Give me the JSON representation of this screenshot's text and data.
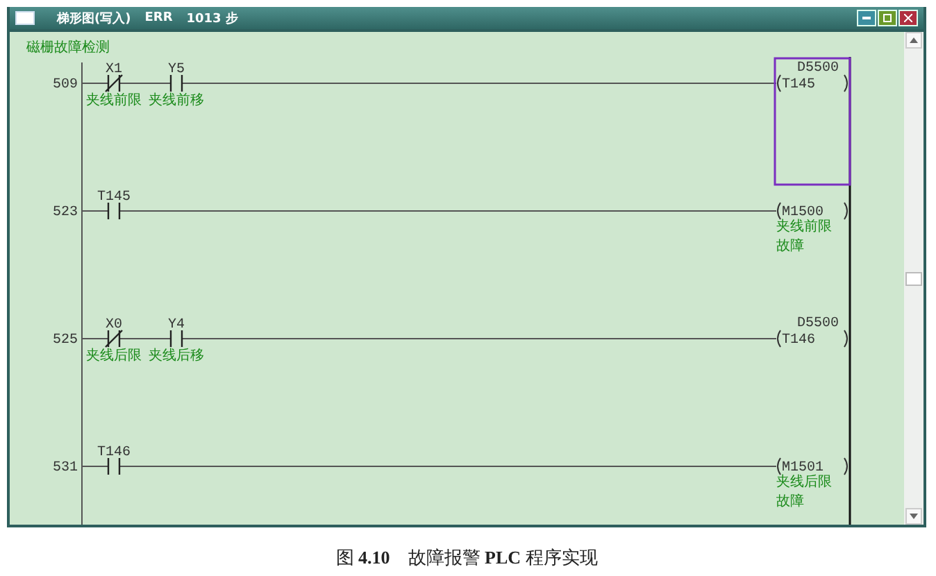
{
  "window": {
    "title": "梯形图(写入)",
    "mode": "ERR",
    "steps": "1013 步"
  },
  "section_title": "磁栅故障检测",
  "rungs": [
    {
      "step": "509",
      "contacts": [
        {
          "kind": "nc",
          "device": "X1",
          "comment": "夹线前限"
        },
        {
          "kind": "no",
          "device": "Y5",
          "comment": "夹线前移"
        }
      ],
      "coil": {
        "device": "T145",
        "operand": "D5500",
        "selected": true
      }
    },
    {
      "step": "523",
      "contacts": [
        {
          "kind": "no",
          "device": "T145"
        }
      ],
      "coil": {
        "device": "M1500",
        "comment": "夹线前限故障",
        "selected": false
      }
    },
    {
      "step": "525",
      "contacts": [
        {
          "kind": "nc",
          "device": "X0",
          "comment": "夹线后限"
        },
        {
          "kind": "no",
          "device": "Y4",
          "comment": "夹线后移"
        }
      ],
      "coil": {
        "device": "T146",
        "operand": "D5500",
        "selected": false
      }
    },
    {
      "step": "531",
      "contacts": [
        {
          "kind": "no",
          "device": "T146"
        }
      ],
      "coil": {
        "device": "M1501",
        "comment": "夹线后限故障",
        "selected": false
      }
    }
  ],
  "caption": "图 **4.10**　故障报警 **PLC** 程序实现"
}
